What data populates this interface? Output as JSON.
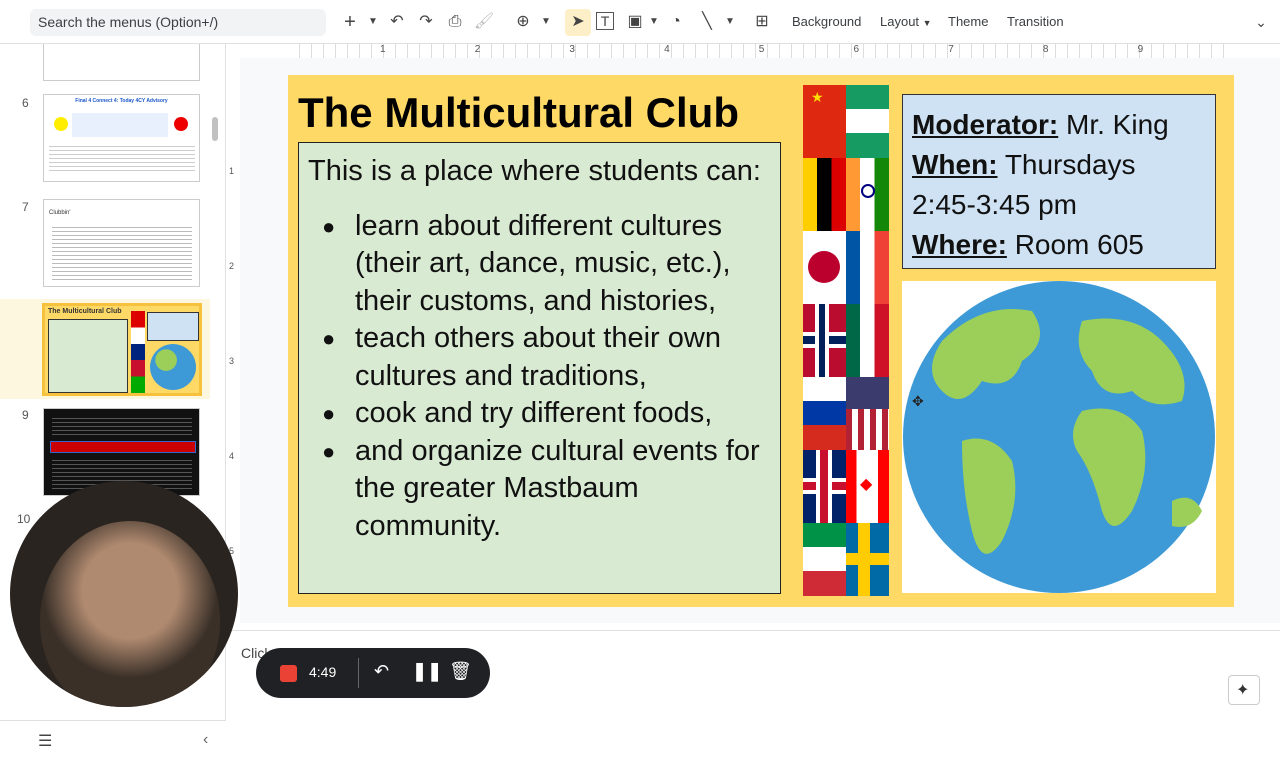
{
  "toolbar": {
    "search_placeholder": "Search the menus (Option+/)",
    "background_label": "Background",
    "layout_label": "Layout",
    "theme_label": "Theme",
    "transition_label": "Transition"
  },
  "ruler": {
    "top_ticks": [
      "1",
      "2",
      "3",
      "4",
      "5",
      "6",
      "7",
      "8",
      "9"
    ],
    "left_ticks": [
      "1",
      "2",
      "3",
      "4",
      "5"
    ]
  },
  "sidebar": {
    "thumbnails": [
      {
        "number": "6",
        "title": "Final 4 Connect 4: Today 4CY Advisory"
      },
      {
        "number": "7",
        "title": "Clubbin'"
      },
      {
        "number": "8",
        "title": "The Multicultural Club"
      },
      {
        "number": "9",
        "title": ""
      },
      {
        "number": "10",
        "title": ""
      }
    ]
  },
  "slide": {
    "title": "The Multicultural Club",
    "intro": "This is a place where students can:",
    "bullets": [
      "learn about different cultures (their art, dance, music, etc.), their customs, and histories,",
      "teach others about their own cultures and traditions,",
      "cook and try different foods,",
      "and organize cultural events for the greater Mastbaum community."
    ],
    "info": {
      "moderator_label": "Moderator:",
      "moderator_value": "Mr. King",
      "when_label": "When:",
      "when_value": "Thursdays",
      "time_value": "2:45-3:45 pm",
      "where_label": "Where:",
      "where_value": "Room 605"
    }
  },
  "notes": {
    "placeholder": "Click"
  },
  "recorder": {
    "time": "4:49"
  },
  "colors": {
    "slide_bg": "#ffd966",
    "desc_bg": "#d9ead3",
    "info_bg": "#cfe2f3",
    "record_red": "#ea4335"
  }
}
